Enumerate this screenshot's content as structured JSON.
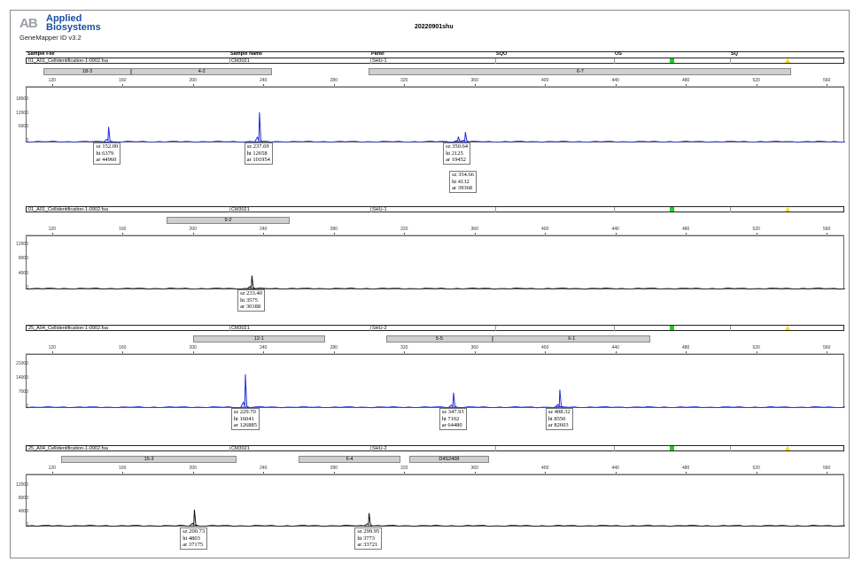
{
  "header": {
    "logo_mark": "AB",
    "logo_line1": "Applied",
    "logo_line2": "Biosystems",
    "app_version": "GeneMapper ID v3.2",
    "run_title": "20220901shu"
  },
  "columns": {
    "sample_file": "Sample File",
    "sample_name": "Sample Name",
    "panel": "Panel",
    "sqo": "SQO",
    "os": "OS",
    "sq": "SQ"
  },
  "x_ticks": [
    120,
    160,
    200,
    240,
    280,
    320,
    360,
    400,
    440,
    480,
    520,
    560
  ],
  "x_range": [
    105,
    570
  ],
  "colors": {
    "blue_trace": "#1f2bd6",
    "black_trace": "#111111",
    "bin_gray": "#cfcfcf",
    "status_green": "#22cc22",
    "status_yellow": "#f2e000"
  },
  "panels": [
    {
      "sample_file": "01_A01_Cellidentification-1-0902.fsa",
      "sample_name": "CM3021",
      "panel": "SHU-1",
      "bins": [
        {
          "label": "18-3",
          "start": 115,
          "end": 165
        },
        {
          "label": "4-2",
          "start": 165,
          "end": 245
        },
        {
          "label": "6-7",
          "start": 300,
          "end": 540
        }
      ],
      "y_ticks": [
        0,
        6000,
        12000,
        18000
      ],
      "y_max": 21000,
      "color": "blue",
      "peaks": [
        {
          "size": 152.0,
          "height": 6379,
          "area": 44960,
          "label": "sz 152.00\nht 6379\nar 44960"
        },
        {
          "size": 237.69,
          "height": 12658,
          "area": 101954,
          "label": "sz 237.69\nht 12658\nar 101954"
        },
        {
          "size": 350.64,
          "height": 2125,
          "area": 19452,
          "label": "sz 350.64\nht 2125\nar 19452"
        },
        {
          "size": 354.66,
          "height": 4132,
          "area": 39368,
          "label": "sz 354.66\nht 4132\nar 39368"
        }
      ]
    },
    {
      "sample_file": "01_A01_Cellidentification-1-0902.fsa",
      "sample_name": "CM3021",
      "panel": "SHU-1",
      "bins": [
        {
          "label": "9-2",
          "start": 185,
          "end": 255
        }
      ],
      "y_ticks": [
        0,
        4000,
        8000,
        12000
      ],
      "y_max": 13000,
      "color": "black",
      "peaks": [
        {
          "size": 233.4,
          "height": 3575,
          "area": 30188,
          "label": "sz 233.40\nht 3575\nar 30188"
        }
      ]
    },
    {
      "sample_file": "25_A04_Cellidentification-1-0902.fsa",
      "sample_name": "CM3021",
      "panel": "SHU-2",
      "bins": [
        {
          "label": "12-1",
          "start": 200,
          "end": 275
        },
        {
          "label": "5-5",
          "start": 310,
          "end": 370
        },
        {
          "label": "X-1",
          "start": 370,
          "end": 460
        }
      ],
      "y_ticks": [
        0,
        7000,
        14000,
        21000
      ],
      "y_max": 23000,
      "color": "blue",
      "peaks": [
        {
          "size": 229.7,
          "height": 16041,
          "area": 126885,
          "label": "sz 229.70\nht 16041\nar 126885"
        },
        {
          "size": 347.93,
          "height": 7102,
          "area": 64480,
          "label": "sz 347.93\nht 7102\nar 64480"
        },
        {
          "size": 408.32,
          "height": 8550,
          "area": 82603,
          "label": "sz 408.32\nht 8550\nar 82603"
        }
      ]
    },
    {
      "sample_file": "25_A04_Cellidentification-1-0902.fsa",
      "sample_name": "CM3021",
      "panel": "SHU-2",
      "bins": [
        {
          "label": "15-3",
          "start": 125,
          "end": 225
        },
        {
          "label": "6-4",
          "start": 260,
          "end": 318
        },
        {
          "label": "D4S2408",
          "start": 323,
          "end": 368
        }
      ],
      "y_ticks": [
        0,
        4000,
        8000,
        12000
      ],
      "y_max": 13500,
      "color": "black",
      "peaks": [
        {
          "size": 200.73,
          "height": 4803,
          "area": 37175,
          "label": "sz 200.73\nht 4803\nar 37175"
        },
        {
          "size": 299.95,
          "height": 3773,
          "area": 33721,
          "label": "sz 299.95\nht 3773\nar 33721"
        }
      ]
    }
  ],
  "chart_data": {
    "type": "line",
    "title": "20220901shu",
    "xlabel": "",
    "ylabel": "",
    "series": [
      {
        "values": [
          {
            "x": 152.0,
            "y": 6379
          },
          {
            "x": 237.69,
            "y": 12658
          },
          {
            "x": 350.64,
            "y": 2125
          },
          {
            "x": 354.66,
            "y": 4132
          }
        ]
      },
      {
        "values": [
          {
            "x": 233.4,
            "y": 3575
          }
        ]
      },
      {
        "values": [
          {
            "x": 229.7,
            "y": 16041
          },
          {
            "x": 347.93,
            "y": 7102
          },
          {
            "x": 408.32,
            "y": 8550
          }
        ]
      },
      {
        "values": [
          {
            "x": 200.73,
            "y": 4803
          },
          {
            "x": 299.95,
            "y": 3773
          }
        ]
      }
    ]
  }
}
